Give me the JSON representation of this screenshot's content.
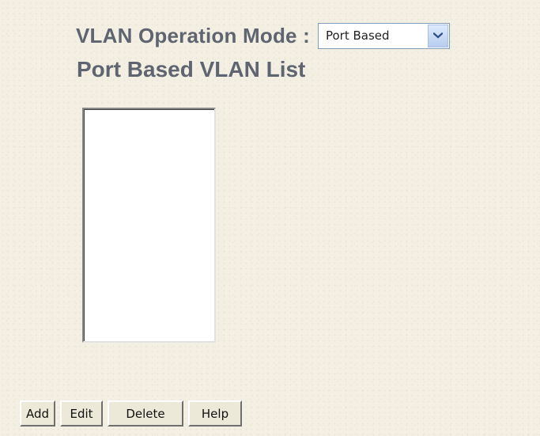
{
  "vlan_mode": {
    "label": "VLAN Operation Mode :",
    "selected_value": "Port Based",
    "dropdown_icon": "chevron-down-icon"
  },
  "vlan_list": {
    "title": "Port Based VLAN List",
    "items": []
  },
  "buttons": {
    "add": "Add",
    "edit": "Edit",
    "delete": "Delete",
    "help": "Help"
  }
}
